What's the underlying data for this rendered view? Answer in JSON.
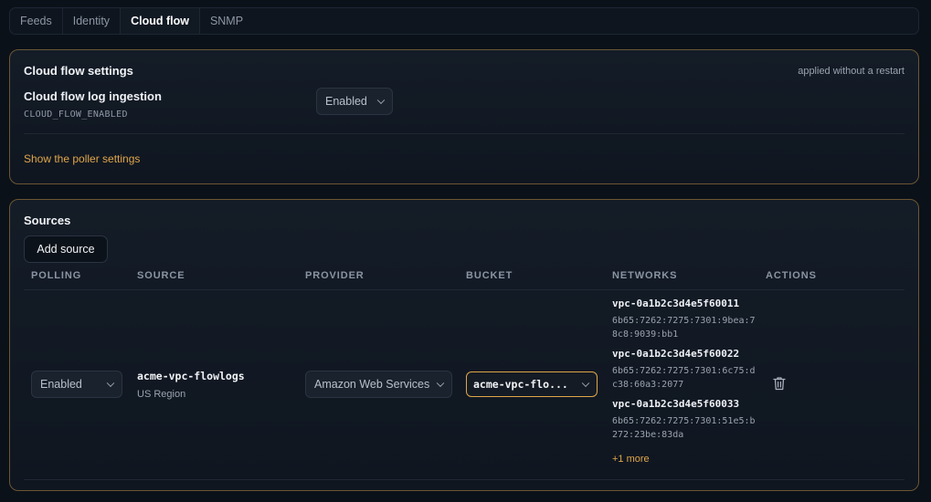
{
  "tabs": [
    "Feeds",
    "Identity",
    "Cloud flow",
    "SNMP"
  ],
  "active_tab": "Cloud flow",
  "settings": {
    "title": "Cloud flow settings",
    "restart_note": "applied without a restart",
    "setting_label": "Cloud flow log ingestion",
    "setting_key": "CLOUD_FLOW_ENABLED",
    "setting_value": "Enabled",
    "poller_link": "Show the poller settings"
  },
  "sources": {
    "title": "Sources",
    "add_button": "Add source",
    "columns": [
      "POLLING",
      "SOURCE",
      "PROVIDER",
      "BUCKET",
      "NETWORKS",
      "ACTIONS"
    ],
    "rows": [
      {
        "polling": "Enabled",
        "source_name": "acme-vpc-flowlogs",
        "source_region": "US Region",
        "provider": "Amazon Web Services",
        "bucket": "acme-vpc-flo...",
        "networks": [
          {
            "id": "vpc-0a1b2c3d4e5f60011",
            "addr": "6b65:7262:7275:7301:9bea:78c8:9039:bb1"
          },
          {
            "id": "vpc-0a1b2c3d4e5f60022",
            "addr": "6b65:7262:7275:7301:6c75:dc38:60a3:2077"
          },
          {
            "id": "vpc-0a1b2c3d4e5f60033",
            "addr": "6b65:7262:7275:7301:51e5:b272:23be:83da"
          }
        ],
        "more_networks": "+1 more",
        "action_icon": "trash-icon"
      }
    ]
  },
  "colors": {
    "accent": "#e0a64a",
    "panel_border": "#6b5633",
    "background": "#0b1119"
  }
}
